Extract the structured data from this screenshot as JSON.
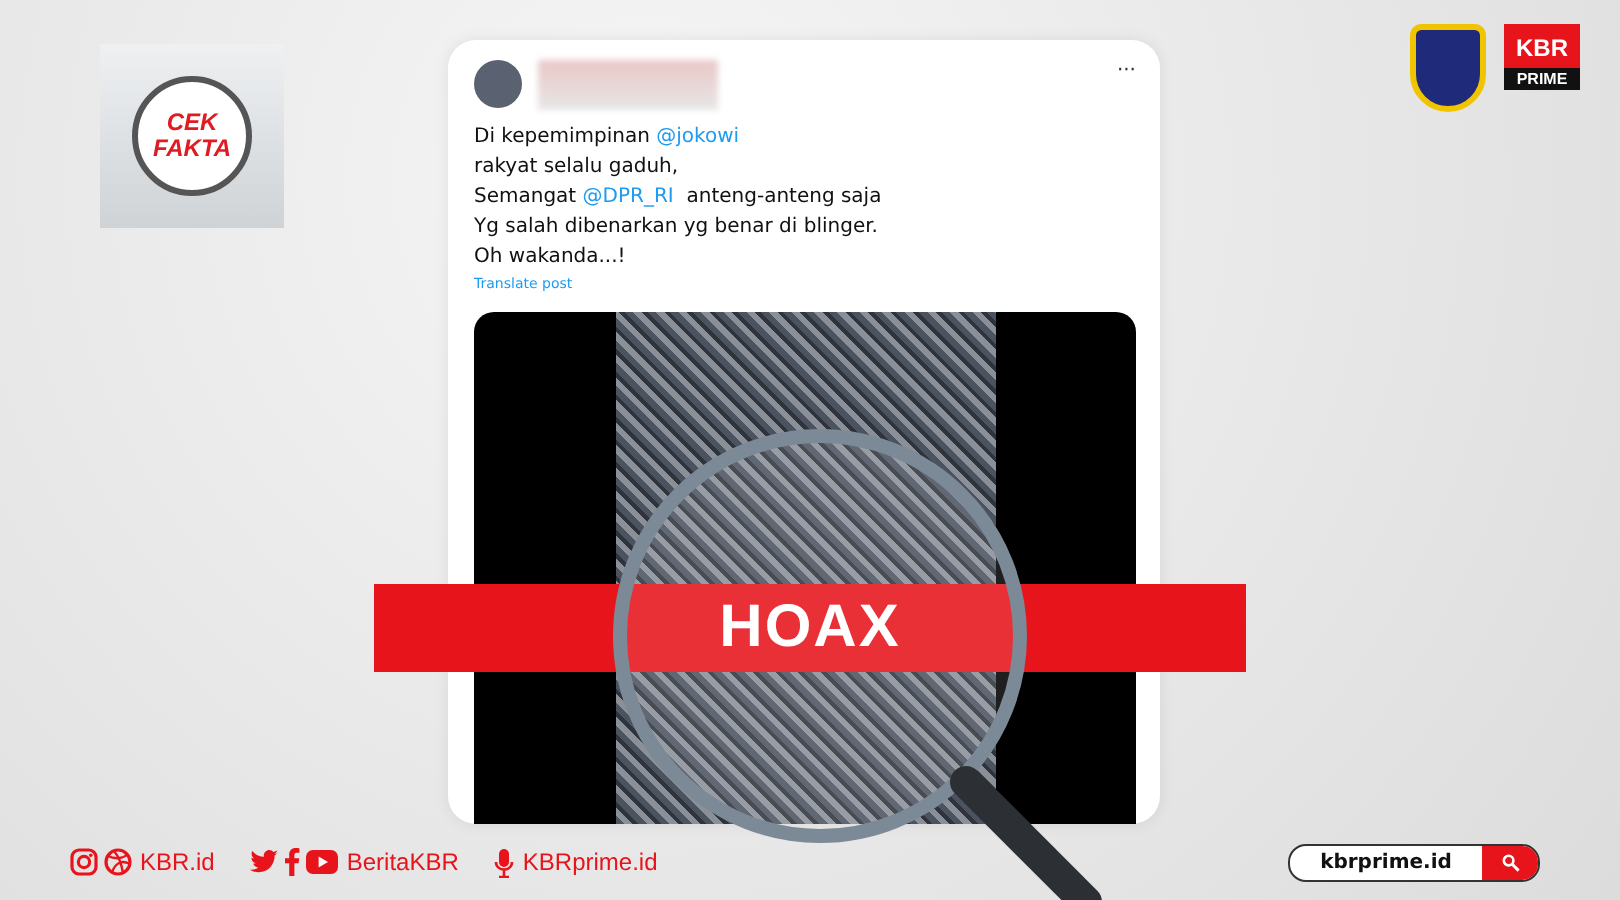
{
  "logo": {
    "line1": "CEK",
    "line2": "FAKTA"
  },
  "brand": {
    "top": "KBR",
    "bottom": "PRIME"
  },
  "tweet": {
    "menu": "···",
    "lines": [
      [
        {
          "kind": "plain",
          "text": "Di kepemimpinan "
        },
        {
          "kind": "mention",
          "text": "@jokowi"
        }
      ],
      [
        {
          "kind": "plain",
          "text": "rakyat selalu gaduh,"
        }
      ],
      [
        {
          "kind": "plain",
          "text": "Semangat "
        },
        {
          "kind": "mention",
          "text": "@DPR_RI"
        },
        {
          "kind": "plain",
          "text": "  anteng-anteng saja"
        }
      ],
      [
        {
          "kind": "plain",
          "text": "Yg salah dibenarkan yg benar di blinger."
        }
      ],
      [
        {
          "kind": "plain",
          "text": "Oh wakanda...!"
        }
      ]
    ],
    "translate": "Translate post"
  },
  "verdict": "HOAX",
  "footer": {
    "groups": [
      {
        "icons": [
          {
            "kind": "instagram"
          },
          {
            "kind": "dribbble"
          }
        ],
        "text": "KBR.id"
      },
      {
        "icons": [
          {
            "kind": "twitter"
          },
          {
            "kind": "facebook"
          },
          {
            "kind": "youtube"
          }
        ],
        "text": "BeritaKBR"
      },
      {
        "icons": [
          {
            "kind": "microphone"
          }
        ],
        "text": "KBRprime.id"
      }
    ],
    "url": "kbrprime.id"
  }
}
